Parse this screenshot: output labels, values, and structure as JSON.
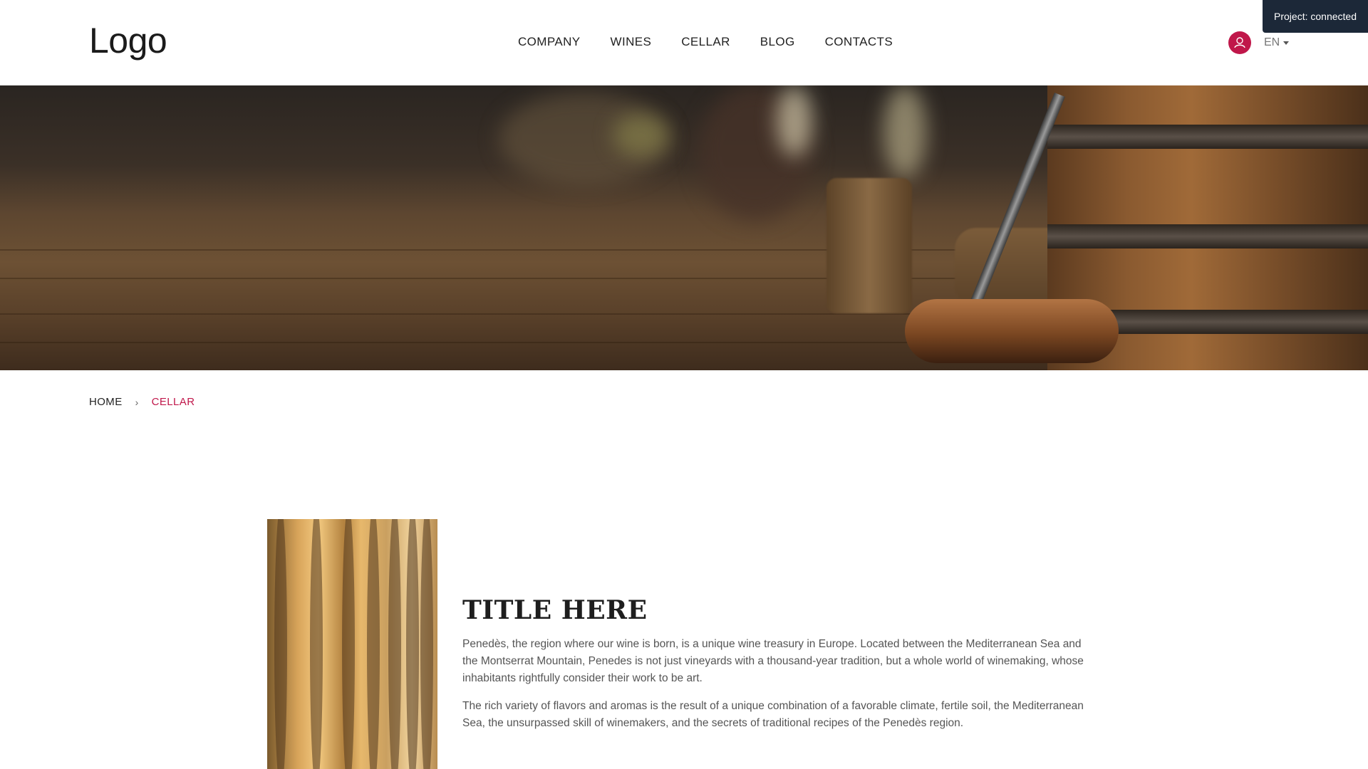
{
  "header": {
    "logo": "Logo",
    "nav": [
      "COMPANY",
      "WINES",
      "CELLAR",
      "BLOG",
      "CONTACTS"
    ],
    "language": "EN",
    "project_status": "Project: connected"
  },
  "breadcrumb": {
    "home": "HOME",
    "current": "CELLAR"
  },
  "content": {
    "title": "TITLE HERE",
    "paragraphs": [
      "Penedès, the region where our wine is born, is a unique wine treasury in Europe. Located between the Mediterranean Sea and the Montserrat Mountain, Penedes is not just vineyards with a thousand-year tradition, but a whole world of winemaking, whose inhabitants rightfully consider their work to be art.",
      "The rich variety of flavors and aromas is the result of a unique combination of a favorable climate, fertile soil, the Mediterranean Sea, the unsurpassed skill of winemakers, and the secrets of traditional recipes of the Penedès region."
    ]
  },
  "colors": {
    "accent": "#c0174a",
    "badge_bg": "#1c2838"
  },
  "icons": {
    "user": "user-icon",
    "language_caret": "caret-down-icon",
    "breadcrumb_separator": "chevron-right-icon"
  }
}
